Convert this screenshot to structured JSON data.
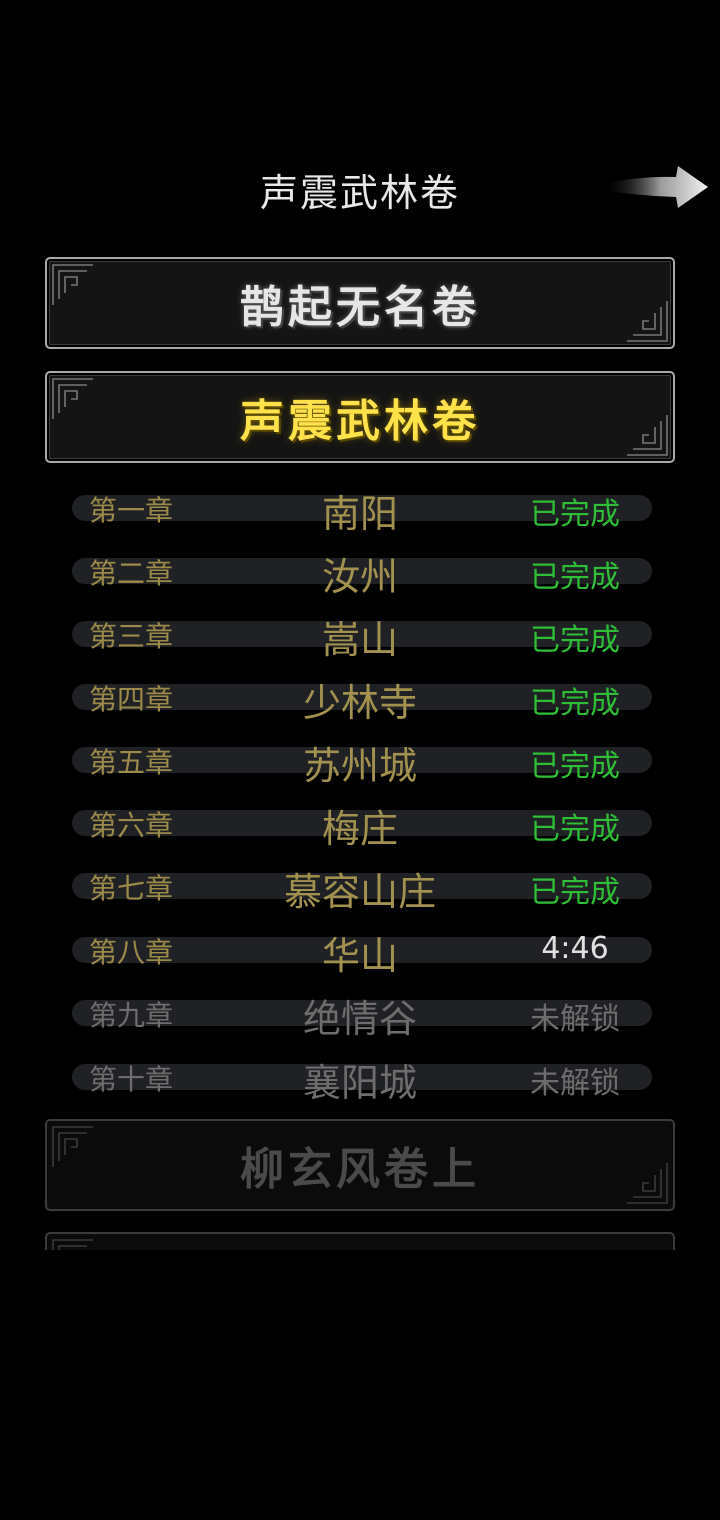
{
  "header": {
    "title": "声震武林卷"
  },
  "volumes": [
    {
      "label": "鹊起无名卷",
      "state": "unlocked"
    },
    {
      "label": "声震武林卷",
      "state": "selected"
    },
    {
      "label": "柳玄风卷上",
      "state": "locked"
    }
  ],
  "chapters": [
    {
      "num": "第一章",
      "name": "南阳",
      "status": "已完成"
    },
    {
      "num": "第二章",
      "name": "汝州",
      "status": "已完成"
    },
    {
      "num": "第三章",
      "name": "嵩山",
      "status": "已完成"
    },
    {
      "num": "第四章",
      "name": "少林寺",
      "status": "已完成"
    },
    {
      "num": "第五章",
      "name": "苏州城",
      "status": "已完成"
    },
    {
      "num": "第六章",
      "name": "梅庄",
      "status": "已完成"
    },
    {
      "num": "第七章",
      "name": "慕容山庄",
      "status": "已完成"
    },
    {
      "num": "第八章",
      "name": "华山",
      "status": "4:46"
    },
    {
      "num": "第九章",
      "name": "绝情谷",
      "status": "未解锁"
    },
    {
      "num": "第十章",
      "name": "襄阳城",
      "status": "未解锁"
    }
  ],
  "colors": {
    "completed": "#2fbf37",
    "selected_volume": "#ffe14a",
    "chapter_text": "#a3924f",
    "locked_text": "#6d6d6d"
  },
  "icons": {
    "next": "arrow-right-icon",
    "frame": "fret-corner-icon"
  }
}
